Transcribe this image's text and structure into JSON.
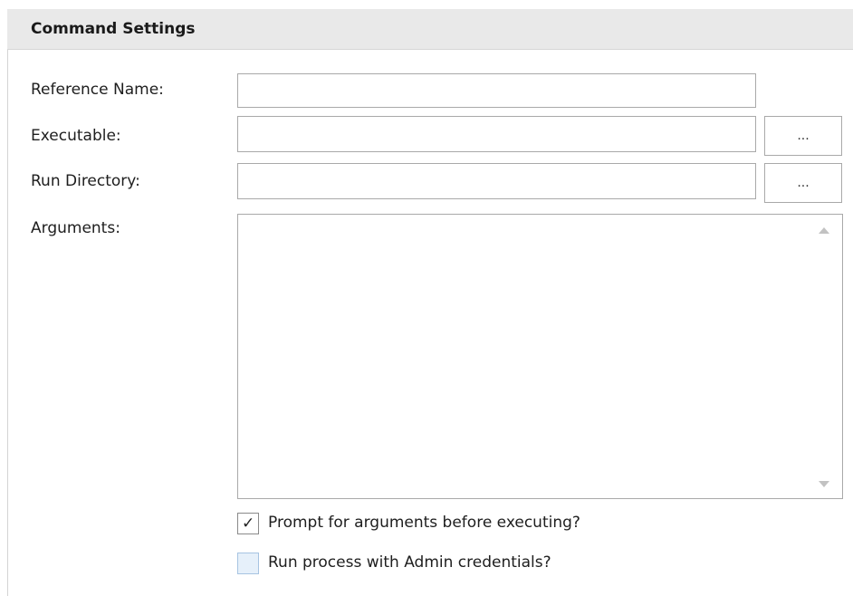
{
  "header": {
    "title": "Command Settings"
  },
  "form": {
    "reference_name": {
      "label": "Reference Name:",
      "value": ""
    },
    "executable": {
      "label": "Executable:",
      "value": "",
      "browse_label": "..."
    },
    "run_directory": {
      "label": "Run Directory:",
      "value": "",
      "browse_label": "..."
    },
    "arguments": {
      "label": "Arguments:",
      "value": ""
    }
  },
  "options": {
    "prompt_for_arguments": {
      "label": "Prompt for arguments before executing?",
      "checked": true,
      "checkmark": "✓"
    },
    "run_as_admin": {
      "label": "Run process with Admin credentials?",
      "checked": false
    }
  },
  "icons": {
    "scroll_up": "triangle-up-icon",
    "scroll_down": "triangle-down-icon",
    "check": "checkmark-icon"
  },
  "colors": {
    "header_background": "#e9e9e9",
    "unchecked_box_fill": "#e6f0fa"
  }
}
